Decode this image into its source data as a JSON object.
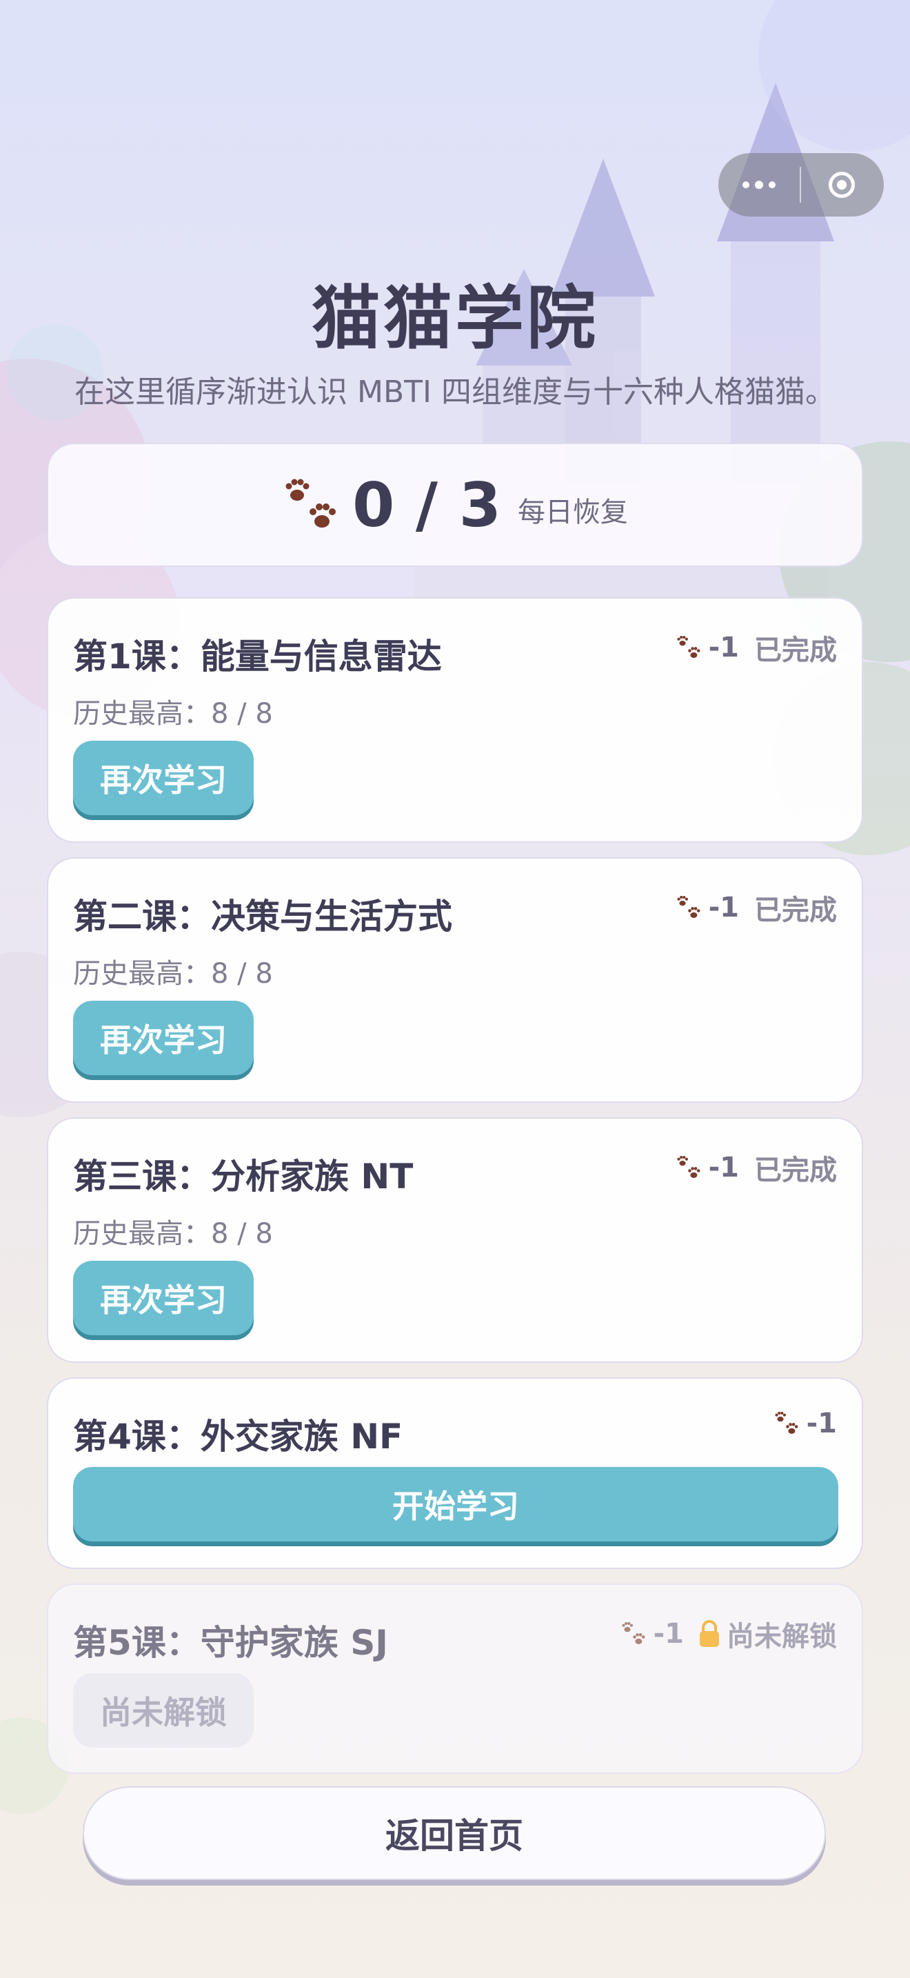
{
  "header": {
    "title": "猫猫学院",
    "subtitle": "在这里循序渐进认识 MBTI 四组维度与十六种人格猫猫。"
  },
  "energy": {
    "count": "0 / 3",
    "recover": "每日恢复"
  },
  "lessons": [
    {
      "title": "第1课：能量与信息雷达",
      "cost": "-1",
      "status": "已完成",
      "best": "历史最高：8 / 8",
      "button": "再次学习"
    },
    {
      "title": "第二课：决策与生活方式",
      "cost": "-1",
      "status": "已完成",
      "best": "历史最高：8 / 8",
      "button": "再次学习"
    },
    {
      "title": "第三课：分析家族 NT",
      "cost": "-1",
      "status": "已完成",
      "best": "历史最高：8 / 8",
      "button": "再次学习"
    },
    {
      "title": "第4课：外交家族 NF",
      "cost": "-1",
      "button": "开始学习"
    },
    {
      "title": "第5课：守护家族 SJ",
      "cost": "-1",
      "status": "尚未解锁",
      "button": "尚未解锁"
    }
  ],
  "footer": {
    "home_button": "返回首页"
  },
  "colors": {
    "accent": "#6cbfd1",
    "paw": "#7a3b2a",
    "text": "#3f3d56"
  }
}
